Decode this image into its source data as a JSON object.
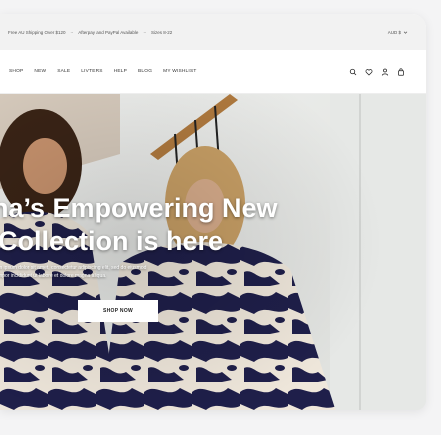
{
  "announcement": {
    "shipping": "Free AU Shipping Over $120",
    "payment": "Afterpay and PayPal Available",
    "sizes": "Sizes 8-22",
    "separator": "~",
    "currency": "AUD $"
  },
  "nav": {
    "links": [
      "SHOP",
      "NEW",
      "SALE",
      "LIVTERS",
      "HELP",
      "BLOG",
      "MY WISHLIST"
    ]
  },
  "icons": [
    "search-icon",
    "heart-icon",
    "user-icon",
    "bag-icon",
    "chevron-down-icon"
  ],
  "hero": {
    "headline_line1": "na’s Empowering New",
    "headline_line2": "Collection is here",
    "subtext_line1": "m ipsum dolor sit amet, consectetur adipiscing elit, sed do eiusmod",
    "subtext_line2": "mpor incididunt ut labore et dolore magna aliqua.",
    "cta": "SHOP NOW"
  },
  "colors": {
    "navy_print": "#1f1f4a",
    "cream_print": "#efe7db",
    "wall": "#e9eae8",
    "stair_wood": "#b07a3f"
  }
}
